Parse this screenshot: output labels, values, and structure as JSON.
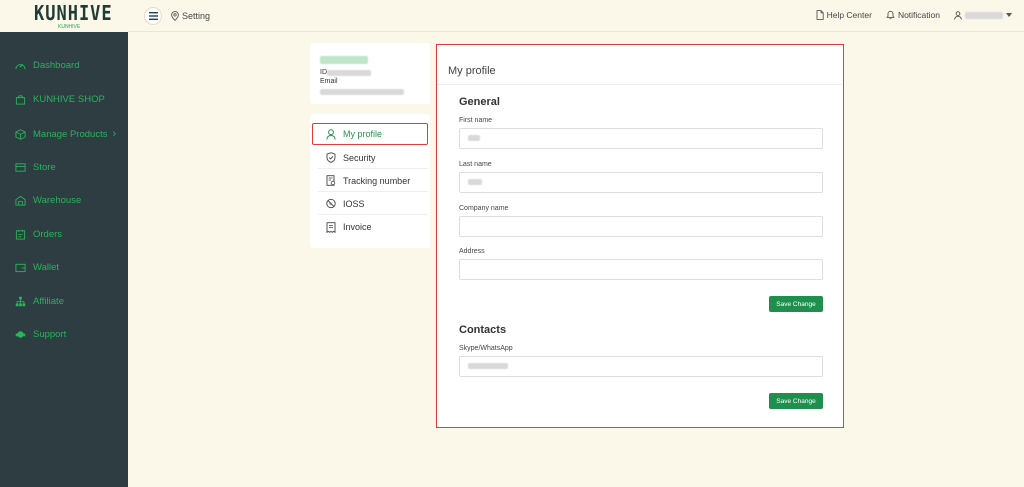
{
  "header": {
    "logo_text": "KUNHIVE",
    "logo_sub": "KUNHIVE",
    "breadcrumb": "Setting",
    "help_center": "Help Center",
    "notification": "Notification"
  },
  "sidebar": {
    "items": [
      {
        "label": "Dashboard",
        "icon": "dashboard-icon"
      },
      {
        "label": "KUNHIVE SHOP",
        "icon": "shop-bag-icon"
      },
      {
        "label": "Manage Products",
        "icon": "box-icon",
        "chevron": "›"
      },
      {
        "label": "Store",
        "icon": "store-icon"
      },
      {
        "label": "Warehouse",
        "icon": "warehouse-icon"
      },
      {
        "label": "Orders",
        "icon": "orders-icon"
      },
      {
        "label": "Wallet",
        "icon": "wallet-icon"
      },
      {
        "label": "Affiliate",
        "icon": "affiliate-icon"
      },
      {
        "label": "Support",
        "icon": "support-icon"
      }
    ]
  },
  "user_card": {
    "id_label": "ID",
    "email_label": "Email"
  },
  "settings_menu": {
    "items": [
      {
        "label": "My profile",
        "icon": "user-icon",
        "active": true
      },
      {
        "label": "Security",
        "icon": "shield-icon"
      },
      {
        "label": "Tracking number",
        "icon": "tracking-icon"
      },
      {
        "label": "IOSS",
        "icon": "ioss-icon"
      },
      {
        "label": "Invoice",
        "icon": "invoice-icon"
      }
    ]
  },
  "profile": {
    "title": "My profile",
    "general_heading": "General",
    "first_name_label": "First name",
    "first_name_value": "",
    "last_name_label": "Last name",
    "last_name_value": "",
    "company_label": "Company name",
    "company_value": "",
    "address_label": "Address",
    "address_value": "",
    "save_label": "Save Change",
    "contacts_heading": "Contacts",
    "skype_label": "Skype/WhatsApp",
    "skype_value": "",
    "save2_label": "Save Change"
  },
  "colors": {
    "sidebar_bg": "#2d3d41",
    "accent_green": "#2bb35e",
    "button_green": "#1f8f4e",
    "highlight_red": "#e23b3b",
    "page_bg": "#fbf7e9"
  }
}
